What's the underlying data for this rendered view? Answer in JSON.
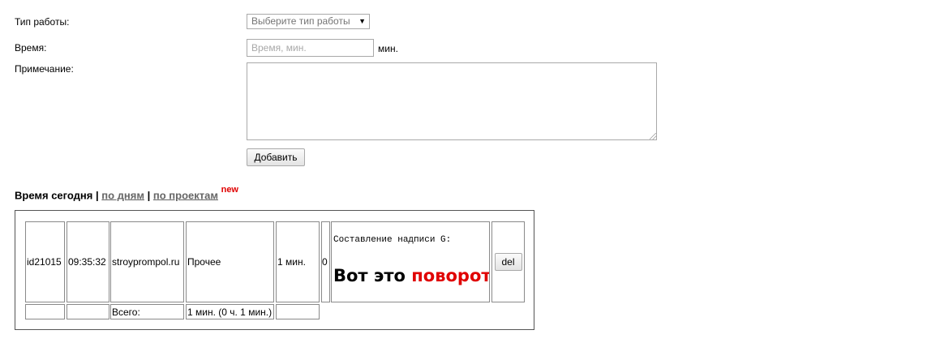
{
  "form": {
    "work_type_label": "Тип работы:",
    "work_type_select": "Выберите тип работы",
    "time_label": "Время:",
    "time_placeholder": "Время, мин.",
    "time_unit": "мин.",
    "note_label": "Примечание:",
    "add_button": "Добавить"
  },
  "heading": {
    "title": "Время сегодня",
    "sep1": "|",
    "by_days": "по дням",
    "sep2": "|",
    "by_projects": "по проектам",
    "new_badge": "new"
  },
  "entry": {
    "id": "id21015",
    "time": "09:35:32",
    "site": "stroyprompol.ru",
    "type": "Прочее",
    "duration": "1 мин.",
    "count": "0",
    "note_title": "Составление надписи G:",
    "note_big_part1": "Вот это",
    "note_big_part2": "поворот",
    "del_button": "del"
  },
  "totals": {
    "label": "Всего:",
    "value": "1 мин. (0 ч. 1 мин.)"
  },
  "colors": {
    "accent_red": "#e00000",
    "link_gray": "#666666"
  }
}
